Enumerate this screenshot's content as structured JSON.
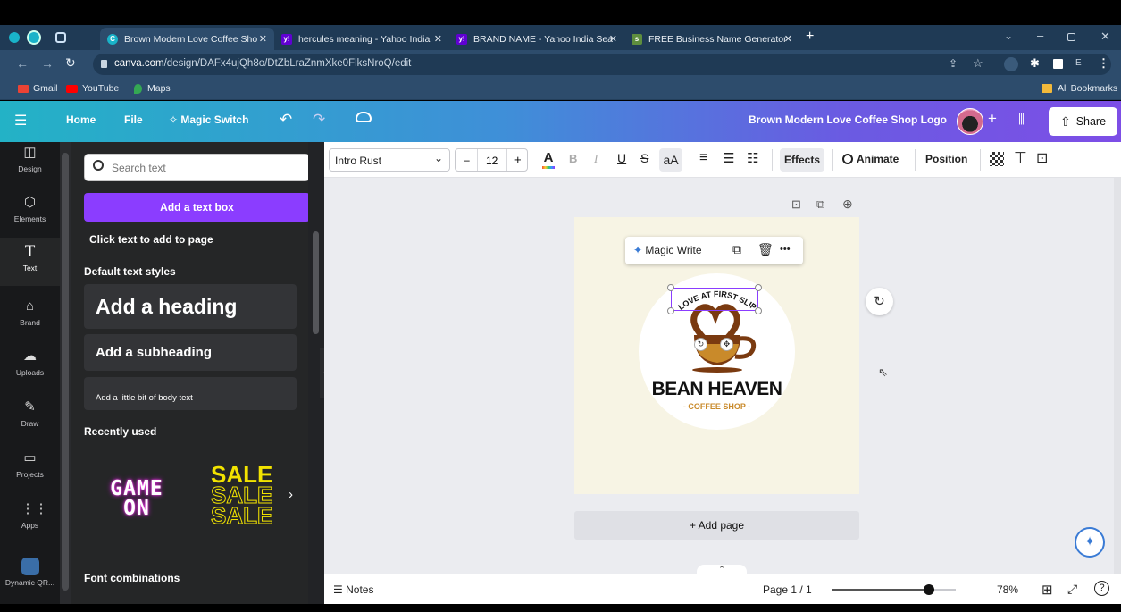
{
  "browser": {
    "tabs": [
      {
        "label": "Brown Modern Love Coffee Sho",
        "active": true
      },
      {
        "label": "hercules meaning - Yahoo India"
      },
      {
        "label": "BRAND NAME - Yahoo India Sea"
      },
      {
        "label": "FREE Business Name Generator"
      }
    ],
    "new_tab": "+",
    "url_host": "canva.com",
    "url_path": "/design/DAFx4ujQh8o/DtZbLraZnmXke0FlksNroQ/edit",
    "bookmarks": [
      "Gmail",
      "YouTube",
      "Maps"
    ],
    "all_bookmarks": "All Bookmarks",
    "profile_letter": "E"
  },
  "header": {
    "home": "Home",
    "file": "File",
    "magic_switch": "Magic Switch",
    "doc_title": "Brown Modern Love Coffee Shop Logo",
    "share": "Share",
    "plus": "+"
  },
  "rail": [
    {
      "label": "Design",
      "icon": "design-icon"
    },
    {
      "label": "Elements",
      "icon": "elements-icon"
    },
    {
      "label": "Text",
      "icon": "text-icon"
    },
    {
      "label": "Brand",
      "icon": "brand-icon"
    },
    {
      "label": "Uploads",
      "icon": "uploads-icon"
    },
    {
      "label": "Draw",
      "icon": "draw-icon"
    },
    {
      "label": "Projects",
      "icon": "projects-icon"
    },
    {
      "label": "Apps",
      "icon": "apps-icon"
    },
    {
      "label": "Dynamic QR...",
      "icon": "dynamic-qr-icon"
    }
  ],
  "panel": {
    "search_placeholder": "Search text",
    "add_textbox": "Add a text box",
    "click_text": "Click text to add to page",
    "default_styles": "Default text styles",
    "heading": "Add a heading",
    "subheading": "Add a subheading",
    "body": "Add a little bit of body text",
    "recently_used": "Recently used",
    "game_on_1": "GAME",
    "game_on_2": "ON",
    "sale": "SALE",
    "font_combinations": "Font combinations"
  },
  "toolbar": {
    "font": "Intro Rust",
    "minus": "–",
    "font_size": "12",
    "plus": "+",
    "bold": "B",
    "italic": "I",
    "underline": "U",
    "strike": "S",
    "case": "aA",
    "effects": "Effects",
    "animate": "Animate",
    "position": "Position"
  },
  "canvas": {
    "magic_write": "Magic Write",
    "more": "•••",
    "logo_arc": "LOVE AT FIRST SLIP",
    "logo_title": "BEAN HEAVEN",
    "logo_subtitle": "- COFFEE SHOP -",
    "add_page": "+ Add page"
  },
  "bottom": {
    "notes": "Notes",
    "page": "Page 1 / 1",
    "zoom": "78%",
    "zoom_level": 0.78,
    "help": "?"
  },
  "colors": {
    "purple": "#8b3dff",
    "logo_brown": "#7a3a10",
    "page_bg": "#f7f4e4"
  }
}
